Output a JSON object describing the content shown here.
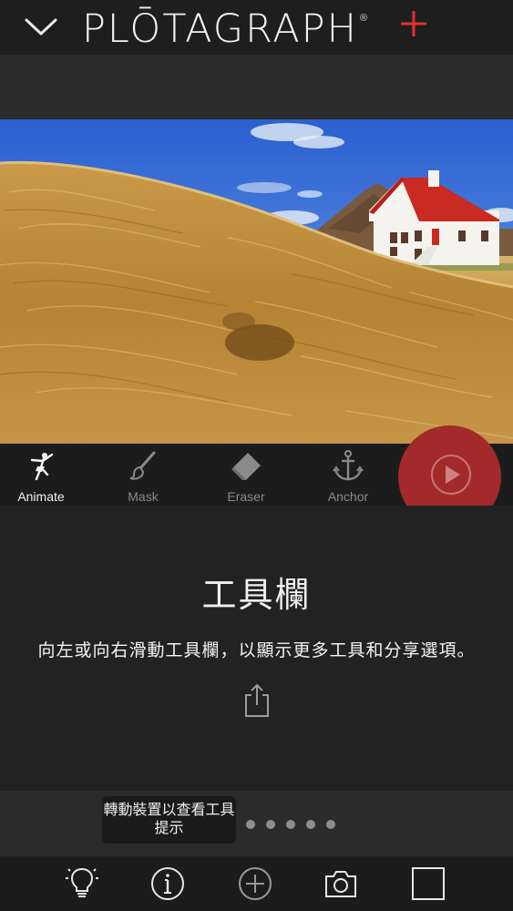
{
  "header": {
    "title": "PLŌTAGRAPH",
    "reg_mark": "®",
    "accent_color": "#e0322d",
    "collapse_icon": "chevron-down-icon",
    "plus_icon": "plus-icon"
  },
  "toolbar": {
    "tools": [
      {
        "label": "Animate",
        "icon": "animate-dancer-icon",
        "active": true
      },
      {
        "label": "Mask",
        "icon": "brush-icon",
        "active": false
      },
      {
        "label": "Eraser",
        "icon": "eraser-icon",
        "active": false
      },
      {
        "label": "Anchor",
        "icon": "anchor-icon",
        "active": false
      }
    ],
    "play_icon": "play-icon",
    "play_color": "#a32a2a"
  },
  "tip": {
    "title": "工具欄",
    "description": "向左或向右滑動工具欄，以顯示更多工具和分享選項。",
    "share_icon": "share-icon"
  },
  "pager": {
    "total_dots": 8,
    "active_index": 0
  },
  "tooltip": {
    "text": "轉動裝置以查看工具提示"
  },
  "bottom_bar": {
    "icons": [
      "lightbulb-icon",
      "info-icon",
      "add-circle-icon",
      "camera-icon",
      "square-icon"
    ]
  }
}
